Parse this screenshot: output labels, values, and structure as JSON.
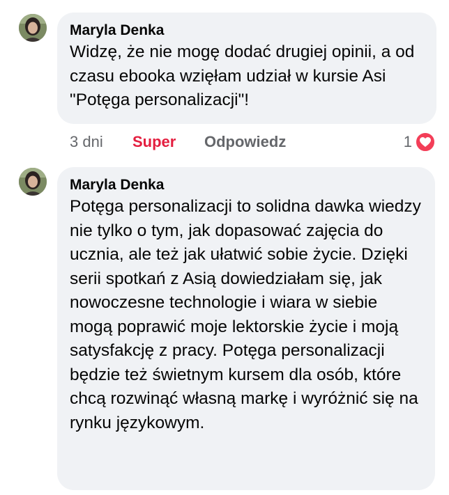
{
  "comments": [
    {
      "author": "Maryla Denka",
      "text": "Widzę, że nie mogę dodać drugiej opinii, a od czasu ebooka wzięłam udział w kursie Asi \"Potęga personalizacji\"!",
      "actions": {
        "time": "3 dni",
        "like": "Super",
        "reply": "Odpowiedz"
      },
      "reaction": {
        "count": "1",
        "icon": "heart-icon",
        "color": "#f33e58"
      }
    },
    {
      "author": "Maryla Denka",
      "text": "Potęga personalizacji to solidna dawka wiedzy nie tylko o tym, jak dopasować zajęcia do ucznia, ale też jak ułatwić sobie życie. Dzięki serii spotkań z Asią dowiedziałam się, jak nowoczesne technologie i wiara w siebie mogą poprawić moje lektorskie życie i moją satysfakcję z pracy. Potęga personalizacji będzie też świetnym kursem dla osób, które chcą rozwinąć własną markę i wyróżnić się na rynku językowym."
    }
  ],
  "colors": {
    "bubble": "#f0f2f5",
    "like_active": "#e41e3f",
    "secondary_text": "#65676b"
  }
}
